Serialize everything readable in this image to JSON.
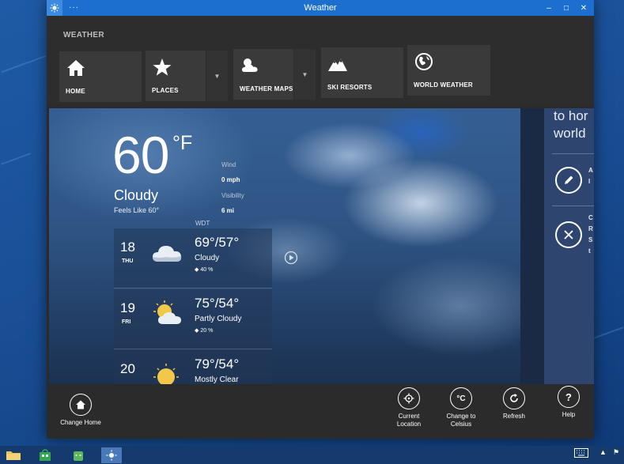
{
  "window": {
    "title": "Weather",
    "menu_dots": "···",
    "minimize": "–",
    "maximize": "□",
    "close": "✕"
  },
  "header": {
    "app_label": "WEATHER",
    "nav": [
      {
        "label": "HOME",
        "icon": "home-icon",
        "has_dropdown": false
      },
      {
        "label": "PLACES",
        "icon": "star-icon",
        "has_dropdown": true
      },
      {
        "label": "WEATHER MAPS",
        "icon": "weather-maps-icon",
        "has_dropdown": true
      },
      {
        "label": "SKI RESORTS",
        "icon": "mountain-icon",
        "has_dropdown": false
      },
      {
        "label": "WORLD WEATHER",
        "icon": "globe-icon",
        "has_dropdown": false
      }
    ],
    "dropdown_glyph": "▼"
  },
  "current": {
    "temperature": "60",
    "unit": "°F",
    "condition": "Cloudy",
    "feels_like": "Feels Like 60°",
    "wind_label": "Wind",
    "wind_value": "0 mph",
    "visibility_label": "Visibility",
    "visibility_value": "6 mi",
    "timezone": "WDT"
  },
  "forecast": [
    {
      "day_num": "18",
      "day_name": "THU",
      "hi_lo": "69°/57°",
      "condition": "Cloudy",
      "precip": "40 %",
      "icon": "cloudy-icon"
    },
    {
      "day_num": "19",
      "day_name": "FRI",
      "hi_lo": "75°/54°",
      "condition": "Partly Cloudy",
      "precip": "20 %",
      "icon": "partly-cloudy-icon"
    },
    {
      "day_num": "20",
      "day_name": "",
      "hi_lo": "79°/54°",
      "condition": "Mostly Clear",
      "precip": "",
      "icon": "mostly-clear-icon"
    }
  ],
  "precip_glyph": "◆",
  "right_panel": {
    "line1": "to hor",
    "line2": "world",
    "snip_a1": "A",
    "snip_a2": "I",
    "snip_b1": "C",
    "snip_b2": "R",
    "snip_b3": "S",
    "snip_b4": "t"
  },
  "appbar": {
    "change_home": "Change Home",
    "current_location": "Current Location",
    "change_to_celsius": "Change to Celsius",
    "celsius_glyph": "°C",
    "refresh": "Refresh",
    "help": "Help",
    "help_glyph": "?"
  },
  "colors": {
    "titlebar": "#1d6fcf",
    "chrome": "#2b2b2b",
    "tile": "#3a3a3a",
    "right_panel": "#2e4570"
  }
}
